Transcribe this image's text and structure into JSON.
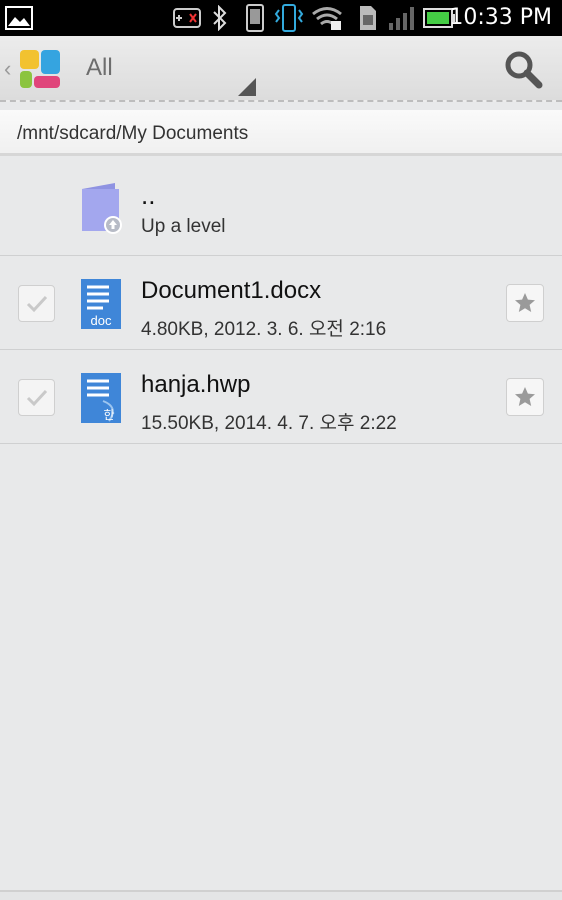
{
  "status_bar": {
    "time": "10:33 PM",
    "icons": [
      "gallery-icon",
      "game-controller-icon",
      "bluetooth-icon",
      "phone-icon",
      "vibrate-icon",
      "wifi-icon",
      "sim-icon",
      "signal-icon",
      "battery-icon"
    ]
  },
  "action_bar": {
    "title": "All",
    "back_glyph": "‹",
    "search_icon": "search-icon"
  },
  "path_bar": {
    "path": "/mnt/sdcard/My Documents"
  },
  "files": {
    "up": {
      "name": "..",
      "meta": "Up a level",
      "icon": "folder-up-icon"
    },
    "items": [
      {
        "name": "Document1.docx",
        "meta": "4.80KB, 2012. 3. 6. 오전 2:16",
        "icon": "docx-file-icon",
        "icon_label": "doc"
      },
      {
        "name": "hanja.hwp",
        "meta": "15.50KB, 2014. 4. 7. 오후 2:22",
        "icon": "hwp-file-icon",
        "icon_label": "한"
      }
    ]
  },
  "colors": {
    "doc_blue": "#3f86d8",
    "folder_purple": "#9ea3ea",
    "background": "#e8e9ea"
  }
}
